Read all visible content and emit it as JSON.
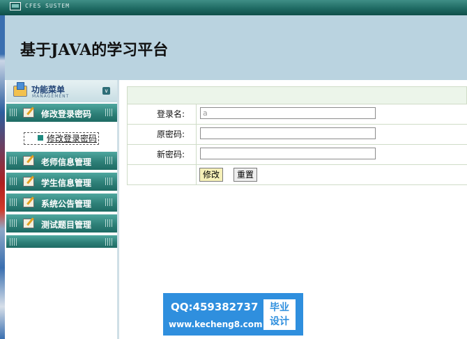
{
  "window": {
    "system_title": "CFES SUSTEM",
    "logo_icon": "window-icon"
  },
  "header": {
    "title": "基于JAVA的学习平台",
    "background": "#bad3e0"
  },
  "sidebar": {
    "menu_title": "功能菜单",
    "menu_subtitle": "MANAGEMENT",
    "items": [
      {
        "label": "修改登录密码",
        "icon": "edit-icon"
      },
      {
        "label": "老师信息管理",
        "icon": "edit-icon"
      },
      {
        "label": "学生信息管理",
        "icon": "edit-icon"
      },
      {
        "label": "系统公告管理",
        "icon": "edit-icon"
      },
      {
        "label": "测试题目管理",
        "icon": "edit-icon"
      }
    ],
    "submenu": {
      "label": "修改登录密码"
    },
    "accent": "#2e8078"
  },
  "form": {
    "username_label": "登录名:",
    "username_value": "a",
    "old_password_label": "原密码:",
    "old_password_value": "",
    "new_password_label": "新密码:",
    "new_password_value": "",
    "modify_label": "修改",
    "reset_label": "重置"
  },
  "watermark": {
    "qq": "QQ:459382737",
    "site": "www.kecheng8.com",
    "tag_line1": "毕业",
    "tag_line2": "设计"
  }
}
